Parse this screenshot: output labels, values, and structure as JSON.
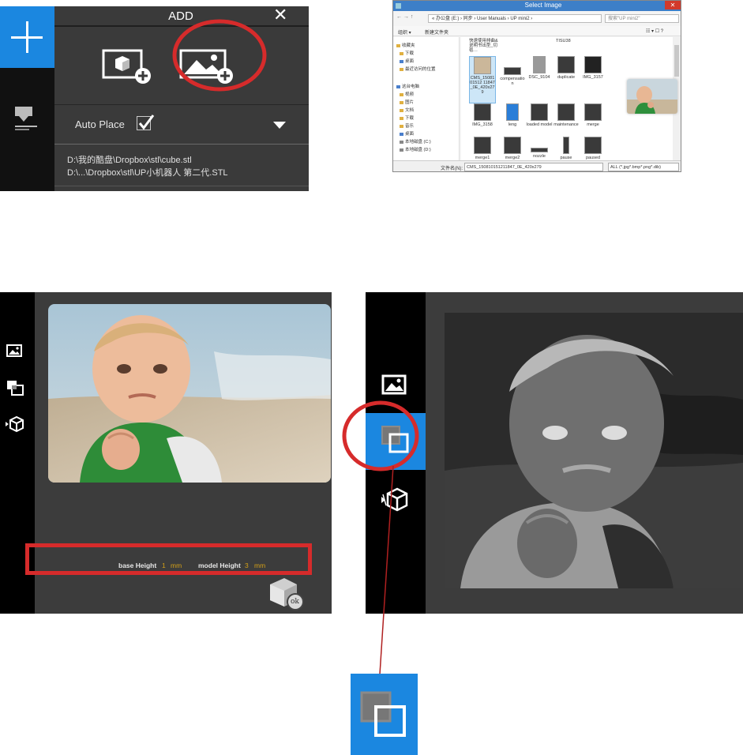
{
  "add_dialog": {
    "title": "ADD",
    "close_glyph": "✕",
    "auto_place_label": "Auto Place",
    "auto_place_checked": true,
    "recent_files": [
      "D:\\我的酷盘\\Dropbox\\stl\\cube.stl",
      "D:\\...\\Dropbox\\stl\\UP小机器人 第二代.STL"
    ],
    "icons": [
      "plus-icon",
      "add-model-icon",
      "add-image-icon",
      "layers-icon"
    ],
    "accent_color": "#1b87e0",
    "highlight_color": "#d62b2b"
  },
  "select_image": {
    "title": "Select Image",
    "close_glyph": "✕",
    "nav": "← → ↑",
    "address": "« 办公盘 (E:) › 同步 › User Manuals › UP mini2 ›",
    "search_placeholder": "搜索\"UP mini2\"",
    "toolbar": {
      "organize": "组织 ▾",
      "new_folder": "新建文件夹",
      "view": "☷ ▾  ☐  ?"
    },
    "sidebar": [
      "收藏夹",
      "下载",
      "桌面",
      "最近访问的位置",
      "这台电脑",
      "视频",
      "图片",
      "文档",
      "下载",
      "音乐",
      "桌面",
      "本地磁盘 (C:)",
      "本地磁盘 (D:)"
    ],
    "top_row_labels": [
      "快速使用排曲&说明书出型_切毯…",
      "TISU38"
    ],
    "files": [
      "CMS_1508101512 11847_0E_420x279",
      "compensation",
      "DSC_9104",
      "duplicate",
      "IMG_3157",
      "IMG_3158",
      "leng",
      "loaded model",
      "maintenance",
      "merge",
      "merge1",
      "merge2",
      "nozzle",
      "pause",
      "paused"
    ],
    "filename_label": "文件名(N):",
    "filename_value": "CMS_150810151211847_0E_420x279",
    "filter_value": "ALL (*.jpg*.bmp*.png*.dib)"
  },
  "editor": {
    "base_height_label": "base Height",
    "base_height_value": "1",
    "base_height_unit": "mm",
    "model_height_label": "model Height",
    "model_height_value": "3",
    "model_height_unit": "mm",
    "ok_label": "ok",
    "tool_icons": [
      "image-icon",
      "invert-icon",
      "model-icon"
    ]
  }
}
